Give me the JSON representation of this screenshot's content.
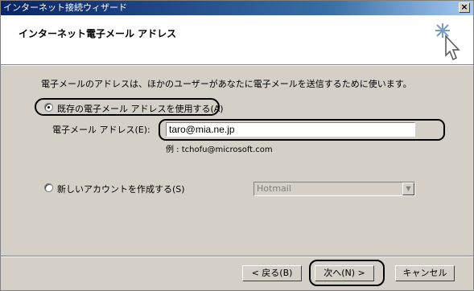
{
  "window": {
    "title": "インターネット接続ウィザード",
    "close_glyph": "×"
  },
  "header": {
    "title": "インターネット電子メール アドレス"
  },
  "description": "電子メールのアドレスは、ほかのユーザーがあなたに電子メールを送信するために使います。",
  "option_existing": {
    "label": "既存の電子メール アドレスを使用する(A)",
    "checked": true
  },
  "email": {
    "label": "電子メール アドレス(E):",
    "value": "taro@mia.ne.jp",
    "example": "例 : tchofu@microsoft.com"
  },
  "option_new": {
    "label": "新しいアカウントを作成する(S)",
    "checked": false
  },
  "account_combo": {
    "value": "Hotmail",
    "disabled": true
  },
  "buttons": {
    "back": "< 戻る(B)",
    "next": "次へ(N) >",
    "cancel": "キャンセル"
  },
  "icons": {
    "wizard": "wizard-sparkle-cursor-icon"
  }
}
